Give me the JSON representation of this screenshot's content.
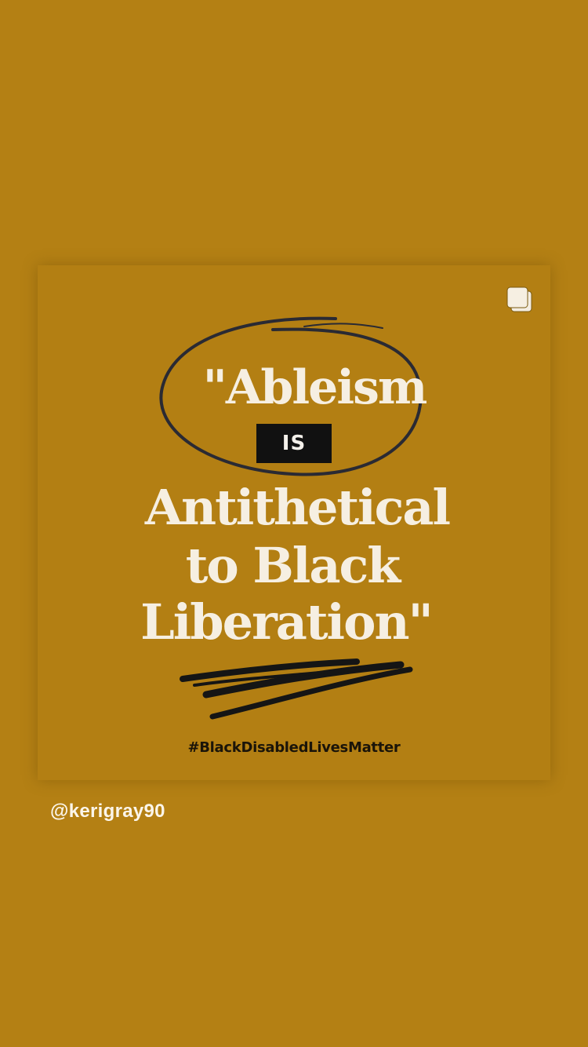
{
  "post": {
    "quote_line_1": "\"Ableism",
    "quote_badge": "IS",
    "quote_line_3": "Antithetical",
    "quote_line_4": "to Black",
    "quote_line_5": "Liberation\"",
    "hashtag": "#BlackDisabledLivesMatter",
    "icons": {
      "multi_post": "carousel-icon"
    }
  },
  "story": {
    "mention": "@kerigray90"
  },
  "colors": {
    "background": "#b48014",
    "text_cream": "#f6efe2",
    "badge_black": "#111111"
  }
}
